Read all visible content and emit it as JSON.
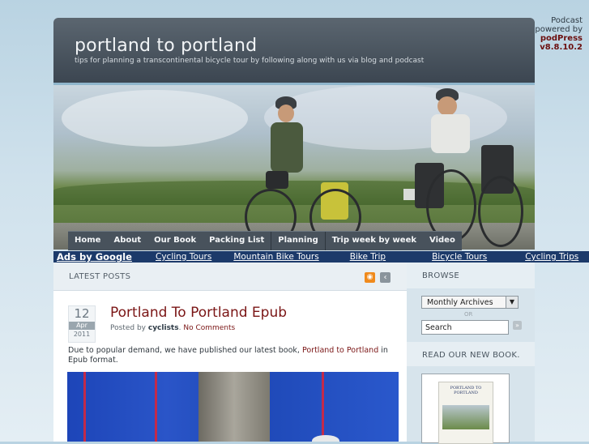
{
  "podpress": {
    "line1": "Podcast",
    "line2": "powered by",
    "brand": "podPress",
    "version": "v8.8.10.2"
  },
  "site": {
    "title": "portland to portland",
    "tagline": "tips for planning a transcontinental bicycle tour by following along with us via blog and podcast"
  },
  "nav": {
    "items": [
      "Home",
      "About",
      "Our Book",
      "Packing List",
      "Planning",
      "Trip week by week",
      "Video"
    ]
  },
  "ads": {
    "label": "Ads by Google",
    "links": [
      "Cycling Tours",
      "Mountain Bike Tours",
      "Bike Trip",
      "Bicycle Tours",
      "Cycling Trips"
    ]
  },
  "latest": {
    "title": "LATEST POSTS"
  },
  "post": {
    "day": "12",
    "month": "Apr",
    "year": "2011",
    "title": "Portland To Portland Epub",
    "posted_by": "Posted by",
    "author": "cyclists",
    "sep": ".",
    "comments": "No Comments",
    "body_pre": "Due to popular demand, we have published our latest book,",
    "body_link": "Portland to Portland",
    "body_post": "in Epub format."
  },
  "sidebar": {
    "browse": "BROWSE",
    "archives_select": "Monthly Archives",
    "or": "OR",
    "search_value": "Search",
    "book_heading": "READ OUR NEW BOOK.",
    "book_cover_text": "PORTLAND TO PORTLAND"
  },
  "colors": {
    "accent": "#7a1515",
    "nav_bg": "#48525c",
    "ad_bar": "#1c3a6a",
    "header_bg": "#3b4550"
  },
  "icons": {
    "rss": "rss-icon",
    "back": "back-arrow-icon",
    "dropdown": "chevron-down-icon",
    "search_go": "search-go-icon"
  }
}
